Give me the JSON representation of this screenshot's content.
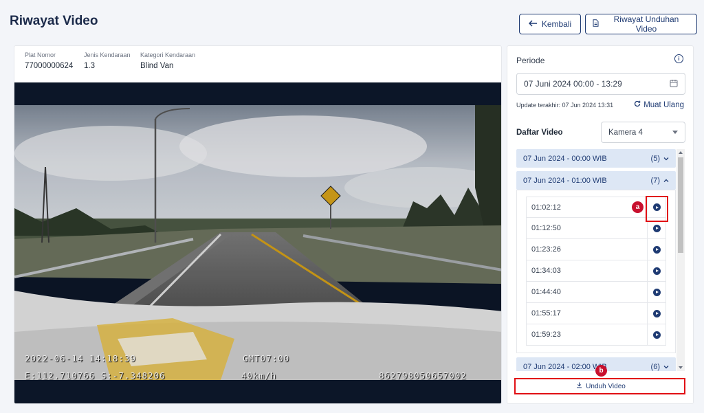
{
  "page": {
    "title": "Riwayat Video"
  },
  "actions": {
    "back_label": "Kembali",
    "download_history_label": "Riwayat Unduhan Video"
  },
  "vehicle": [
    {
      "label": "Plat Nomor",
      "value": "77000000624"
    },
    {
      "label": "Jenis Kendaraan",
      "value": "1.3"
    },
    {
      "label": "Kategori Kendaraan",
      "value": "Blind Van"
    }
  ],
  "video": {
    "osd_datetime": "2022-06-14 14:18:39",
    "osd_timezone": "GMT07:00",
    "osd_coords": "E:112.710766 S:-7.348206",
    "osd_speed": "40km/h",
    "osd_device": "862798050657002"
  },
  "filter": {
    "periode_label": "Periode",
    "periode_value": "07 Juni 2024 00:00 - 13:29",
    "update_text": "Update terakhir: 07 Jun 2024 13:31",
    "reload_label": "Muat Ulang",
    "list_label": "Daftar Video",
    "camera_value": "Kamera 4"
  },
  "groups": [
    {
      "title": "07 Jun 2024 - 00:00 WIB",
      "count": "(5)"
    },
    {
      "title": "07 Jun 2024 - 01:00 WIB",
      "count": "(7)"
    },
    {
      "title": "07 Jun 2024 - 02:00 WIB",
      "count": "(6)"
    }
  ],
  "videos": [
    "01:02:12",
    "01:12:50",
    "01:23:26",
    "01:34:03",
    "01:44:40",
    "01:55:17",
    "01:59:23"
  ],
  "download_label": "Unduh Video",
  "annotations": {
    "a": "a",
    "b": "b"
  },
  "colors": {
    "primary": "#1f3b73",
    "highlight": "#e10f14",
    "group_bg": "#dde7f5"
  }
}
